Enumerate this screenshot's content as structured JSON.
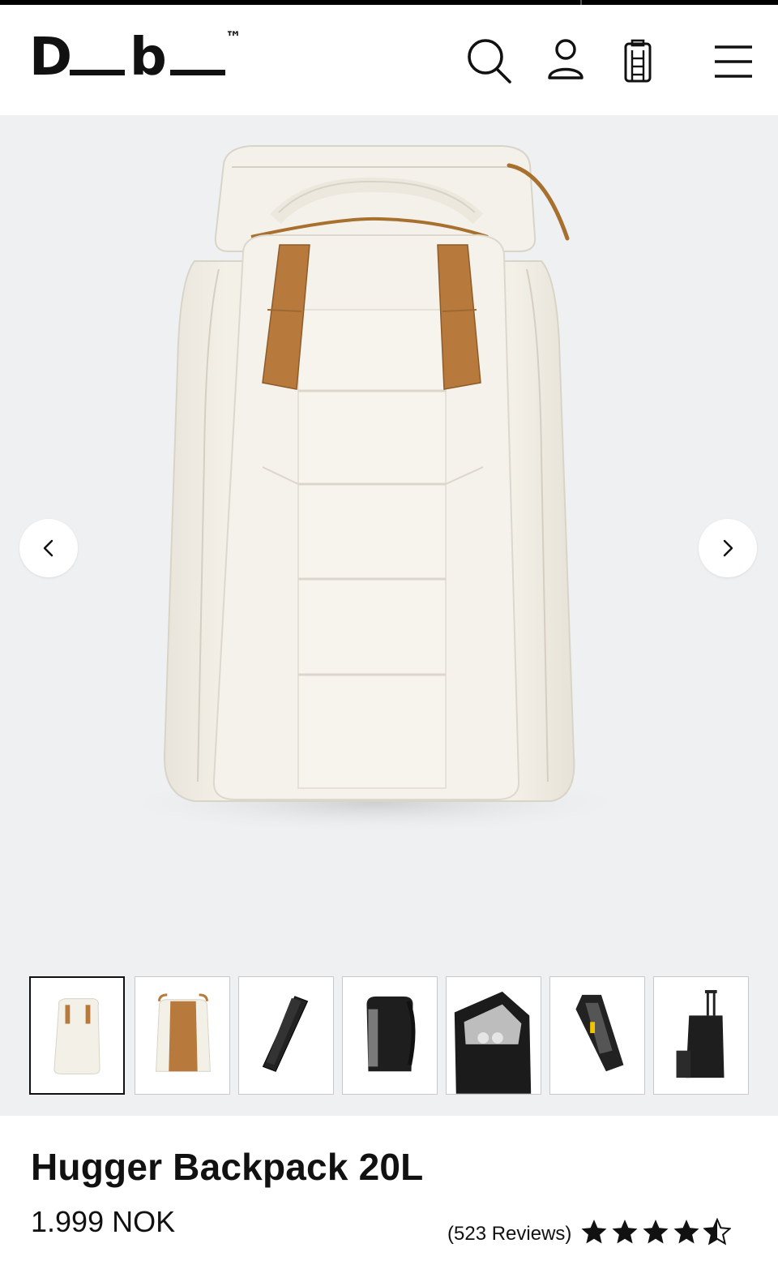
{
  "brand": {
    "logo_text": "D_b_",
    "trademark": "™"
  },
  "header": {
    "icons": [
      "search-icon",
      "account-icon",
      "cart-icon",
      "menu-icon"
    ]
  },
  "gallery": {
    "thumbnails": [
      "front-cream",
      "back-cream",
      "side-black",
      "back-black",
      "open-black",
      "side-open-black",
      "trolley-black"
    ],
    "active_index": 0
  },
  "product": {
    "title": "Hugger Backpack 20L",
    "price": "1.999 NOK",
    "reviews_label": "(523 Reviews)",
    "rating": 4.5,
    "rating_max": 5
  },
  "colors": {
    "gallery_bg": "#eef0f2",
    "bag_body": "#f1eee5",
    "strap": "#b77a3c",
    "text": "#111111"
  }
}
